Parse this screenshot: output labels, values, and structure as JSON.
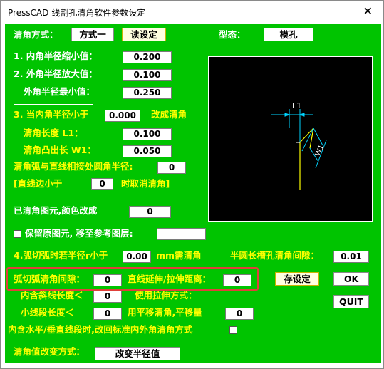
{
  "window": {
    "title": "PressCAD  线割孔清角软件参数设定",
    "close_glyph": "✕"
  },
  "top": {
    "clean_method_label": "清角方式：",
    "method_button": "方式一",
    "read_settings_button": "读设定",
    "type_label": "型态：",
    "type_button": "模孔"
  },
  "params": {
    "inner_shrink_label": "1. 内角半径缩小值：",
    "inner_shrink_value": "0.200",
    "outer_enlarge_label": "2. 外角半径放大值：",
    "outer_enlarge_value": "0.100",
    "outer_min_label": "外角半径最小值：",
    "outer_min_value": "0.250",
    "inner_less_label": "3. 当内角半径小于",
    "inner_less_value": "0.000",
    "change_clean_label": "改成清角",
    "clean_length_label": "清角长度  L1：",
    "clean_length_value": "0.100",
    "protrude_label": "清角凸出长 W1：",
    "protrude_value": "0.050",
    "arc_fillet_label": "清角弧与直线相接处圆角半径:",
    "arc_fillet_value": "0",
    "line_less_label": "[直线边小于",
    "line_less_value": "0",
    "cancel_fillet_label": "时取消清角]",
    "color_change_label": "已清角图元,颜色改成",
    "color_change_value": "0",
    "keep_original_label": "保留原图元, 移至参考图层:",
    "keep_original_value": "",
    "arc_radius_label": "4.弧切弧时若半径r小于",
    "arc_radius_value": "0.00",
    "mm_label": "mm需清角",
    "slot_gap_label": "半圆长槽孔清角间隙：",
    "slot_gap_value": "0.01",
    "arc_gap_label": "弧切弧清角间隙：",
    "arc_gap_value": "0",
    "extend_label": "直线延伸/拉伸距离：",
    "extend_value": "0",
    "inner_slant_label": "内含斜线长度＜",
    "inner_slant_value": "0",
    "use_stretch_label": "使用拉伸方式：",
    "short_seg_label": "小线段长度＜",
    "short_seg_value": "0",
    "parallel_label": "用平移清角,平移量",
    "parallel_value": "0",
    "horiz_vert_label": "内含水平/垂直线段时,改回标准内外角清角方式",
    "change_mode_label": "清角值改变方式：",
    "change_radius_button": "改变半径值"
  },
  "buttons": {
    "save": "存设定",
    "ok": "OK",
    "quit": "QUIT"
  },
  "preview": {
    "l1_label": "L1",
    "w1_label": "W1"
  },
  "colors": {
    "background": "#00c400",
    "label_white": "#ffffff",
    "label_yellow": "#ffff00",
    "highlight": "#e0403a",
    "diagram_cyan": "#00d4ff"
  }
}
